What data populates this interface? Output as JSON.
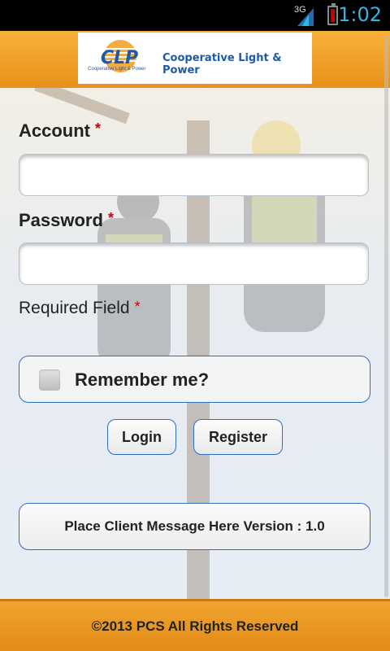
{
  "status_bar": {
    "network_type": "3G",
    "time": "1:02"
  },
  "header": {
    "logo_mark": "CLP",
    "logo_subtitle": "Cooperative Light & Power",
    "company_name": "Cooperative Light & Power"
  },
  "form": {
    "account_label": "Account",
    "account_value": "",
    "password_label": "Password",
    "password_value": "",
    "required_marker": "*",
    "required_field_label": "Required Field",
    "remember_label": "Remember me?",
    "remember_checked": false
  },
  "buttons": {
    "login": "Login",
    "register": "Register"
  },
  "message": {
    "text": "Place Client Message Here Version : 1.0"
  },
  "footer": {
    "copyright": "©2013 PCS All Rights Reserved"
  },
  "colors": {
    "header_orange": "#f0a42f",
    "accent_blue": "#2e6fb8",
    "required_red": "#cc0000",
    "status_time": "#33b5e5"
  }
}
